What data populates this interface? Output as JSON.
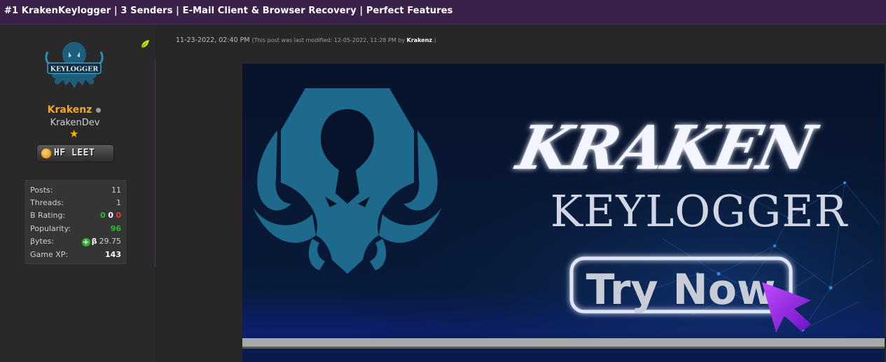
{
  "thread": {
    "title": "#1 KrakenKeylogger | 3 Senders | E-Mail Client & Browser Recovery | Perfect Features"
  },
  "user": {
    "username": "Krakenz",
    "title": "KrakenDev",
    "avatar_text": "KEYLOGGER",
    "badge_text": "HF LEET",
    "stats": {
      "posts_label": "Posts:",
      "posts_value": "11",
      "threads_label": "Threads:",
      "threads_value": "1",
      "brating_label": "B Rating:",
      "brating_pos": "0",
      "brating_neutral": "0",
      "brating_neg": "0",
      "popularity_label": "Popularity:",
      "popularity_value": "96",
      "bytes_label": "βytes:",
      "bytes_symbol": "β",
      "bytes_value": "29.75",
      "gamexp_label": "Game XP:",
      "gamexp_value": "143"
    }
  },
  "post": {
    "date": "11-23-2022, 02:40 PM",
    "modified_prefix": "(This post was last modified: 12-05-2022, 11:28 PM by",
    "modified_by": "Krakenz",
    "modified_suffix": ".)"
  },
  "banner": {
    "brand": "KRAKEN",
    "product": "KEYLOGGER",
    "cta": "Try Now"
  },
  "colors": {
    "titlebar": "#3a2149",
    "username": "#f4a623",
    "banner_bg": "#06162e",
    "kraken_logo": "#1e6a8c"
  }
}
